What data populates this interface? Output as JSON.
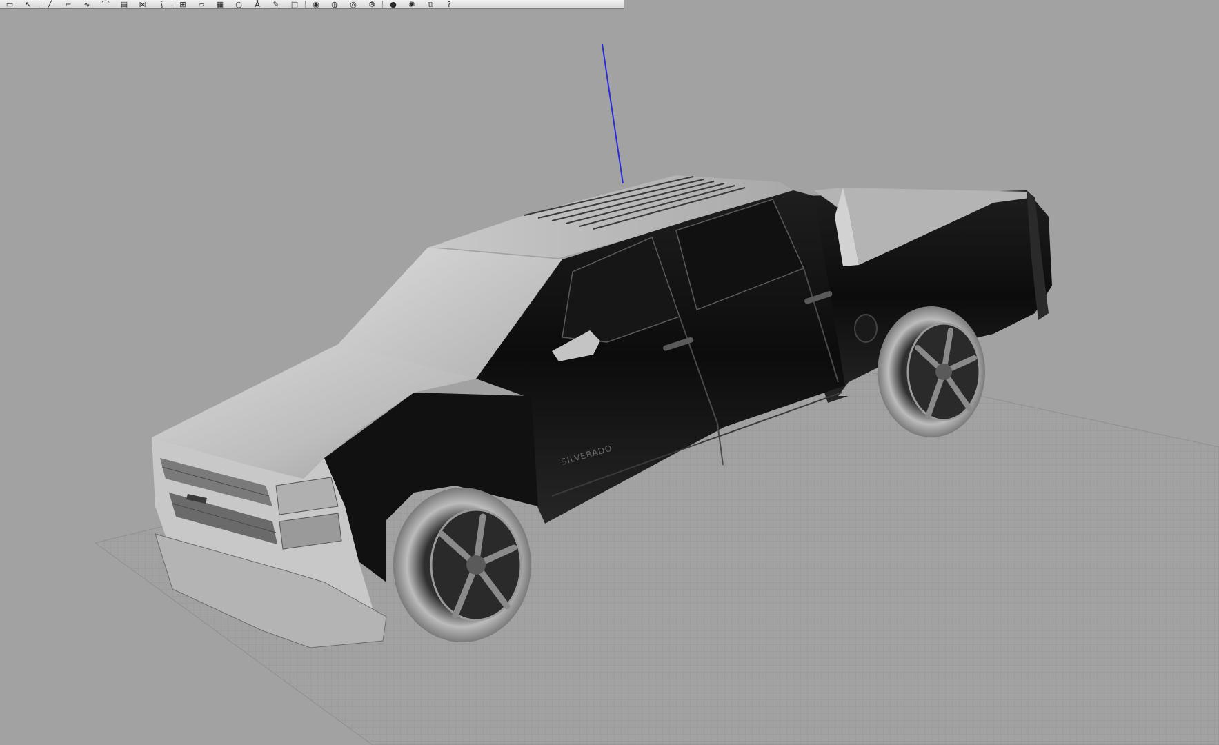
{
  "app": {
    "type": "3d-modeling-viewport"
  },
  "toolbar": {
    "buttons": [
      {
        "icon": "new-file-icon",
        "glyph": "▭"
      },
      {
        "icon": "arrow-select-icon",
        "glyph": "↖"
      },
      {
        "icon": "line-icon",
        "glyph": "╱"
      },
      {
        "icon": "polyline-icon",
        "glyph": "⌐"
      },
      {
        "icon": "curve-icon",
        "glyph": "∿"
      },
      {
        "icon": "arc-icon",
        "glyph": "⌒"
      },
      {
        "icon": "surface-icon",
        "glyph": "▤"
      },
      {
        "icon": "loft-icon",
        "glyph": "⋈"
      },
      {
        "icon": "sweep-icon",
        "glyph": "⟆"
      },
      {
        "icon": "grid-icon",
        "glyph": "⊞"
      },
      {
        "icon": "plane-icon",
        "glyph": "▱"
      },
      {
        "icon": "mesh-icon",
        "glyph": "▦"
      },
      {
        "icon": "circle-icon",
        "glyph": "○"
      },
      {
        "icon": "dimension-icon",
        "glyph": "Å"
      },
      {
        "icon": "pen-icon",
        "glyph": "✎"
      },
      {
        "icon": "box-icon",
        "glyph": "□"
      },
      {
        "icon": "sphere-icon",
        "glyph": "◉"
      },
      {
        "icon": "globe-icon",
        "glyph": "◍"
      },
      {
        "icon": "torus-icon",
        "glyph": "◎"
      },
      {
        "icon": "gear-icon",
        "glyph": "⚙"
      },
      {
        "icon": "render-sphere-icon",
        "glyph": "●"
      },
      {
        "icon": "light-icon",
        "glyph": "✺"
      },
      {
        "icon": "copy-icon",
        "glyph": "⧉"
      },
      {
        "icon": "help-icon",
        "glyph": "?"
      }
    ]
  },
  "viewport": {
    "background_color": "#a2a2a2",
    "grid_color": "#949494",
    "z_axis_color": "#2b2bd8",
    "model": {
      "badge_text": "SILVERADO"
    }
  }
}
